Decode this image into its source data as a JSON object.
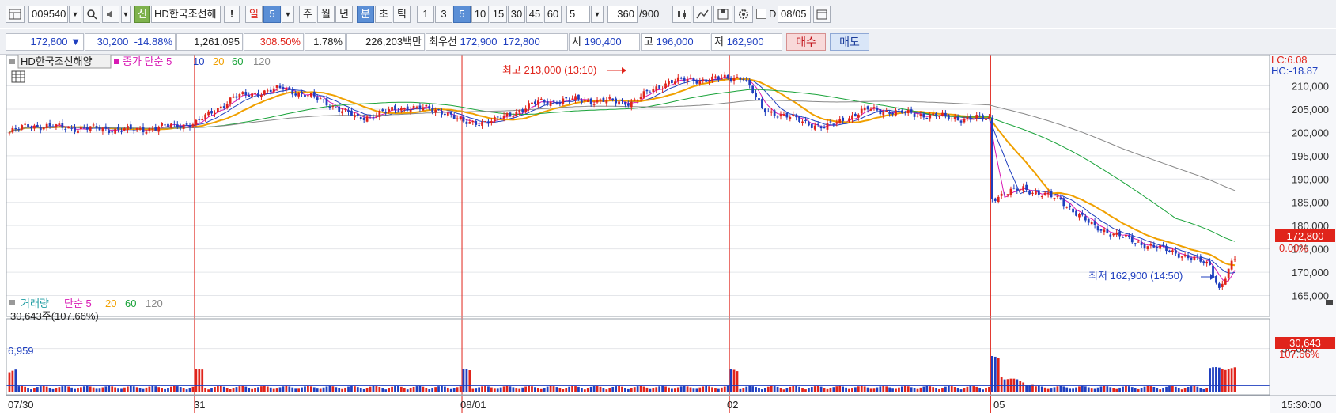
{
  "toolbar": {
    "code": "009540",
    "name_badge": "신",
    "name": "HD한국조선해",
    "alert": "!",
    "period_day": "일",
    "period_day_n": "5",
    "period_week": "주",
    "period_month": "월",
    "period_year": "년",
    "period_minute": "분",
    "period_second": "초",
    "period_tick": "틱",
    "intervals": [
      "1",
      "3",
      "5",
      "10",
      "15",
      "30",
      "45",
      "60"
    ],
    "interval_value": "5",
    "count": "360",
    "count_total": "/900",
    "checkbox_label": "D",
    "date": "08/05"
  },
  "infobar": {
    "price": "172,800",
    "change_arrow": "▼",
    "change": "30,200",
    "change_pct": "-14.88%",
    "volume": "1,261,095",
    "volume_ratio": "308.50%",
    "turnover": "1.78%",
    "amount": "226,203백만",
    "best_label": "최우선",
    "best_ask": "172,900",
    "best_bid": "172,800",
    "open_label": "시",
    "open": "190,400",
    "high_label": "고",
    "high": "196,000",
    "low_label": "저",
    "low": "162,900",
    "buy_label": "매수",
    "sell_label": "매도"
  },
  "price_panel": {
    "name": "HD한국조선해양",
    "series_label": "종가 단순 5",
    "ma_labels": [
      "10",
      "20",
      "60",
      "120"
    ],
    "ma_colors": [
      "#1f3fbf",
      "#f0a000",
      "#1aa33a",
      "#888888"
    ],
    "ma5_color": "#d81ab4",
    "lc_text": "LC:6.08",
    "hc_text": "HC:-18.87",
    "high_annotation": "최고 213,000 (13:10)",
    "low_annotation": "최저 162,900 (14:50)",
    "current_price_label": "172,800",
    "current_pct_label": "0.00%"
  },
  "volume_panel": {
    "title": "거래량",
    "series_label": "단순 5",
    "ma_labels": [
      "20",
      "60",
      "120"
    ],
    "current_text": "30,643주(107.66%)",
    "left_value": "6,959",
    "right_value": "30,643",
    "right_pct": "107.66%"
  },
  "x_axis": {
    "labels": [
      "07/30",
      "31",
      "08/01",
      "02",
      "05"
    ],
    "time_label": "15:30:00"
  },
  "chart_data": {
    "type": "candlestick",
    "title": "HD한국조선해양",
    "interval": "5분",
    "y_ticks": [
      165000,
      170000,
      175000,
      180000,
      185000,
      190000,
      195000,
      200000,
      205000,
      210000
    ],
    "ylim": [
      160500,
      214000
    ],
    "day_labels": [
      "07/30",
      "31",
      "08/01",
      "02",
      "05"
    ],
    "day_anchors": [
      {
        "index": 0,
        "price": 200000
      },
      {
        "index": 6,
        "price": 201500
      },
      {
        "index": 20,
        "price": 201000
      },
      {
        "index": 40,
        "price": 200500
      },
      {
        "index": 60,
        "price": 202000
      },
      {
        "index": 72,
        "price": 207500
      },
      {
        "index": 88,
        "price": 209500
      },
      {
        "index": 100,
        "price": 207000
      },
      {
        "index": 112,
        "price": 203000
      },
      {
        "index": 128,
        "price": 205500
      },
      {
        "index": 140,
        "price": 204500
      },
      {
        "index": 146,
        "price": 202000
      },
      {
        "index": 156,
        "price": 202500
      },
      {
        "index": 170,
        "price": 206500
      },
      {
        "index": 182,
        "price": 207000
      },
      {
        "index": 200,
        "price": 206500
      },
      {
        "index": 212,
        "price": 211000
      },
      {
        "index": 228,
        "price": 211500
      },
      {
        "index": 236,
        "price": 212000
      },
      {
        "index": 242,
        "price": 205000
      },
      {
        "index": 252,
        "price": 203000
      },
      {
        "index": 262,
        "price": 201000
      },
      {
        "index": 276,
        "price": 205000
      },
      {
        "index": 290,
        "price": 204000
      },
      {
        "index": 306,
        "price": 203000
      },
      {
        "index": 315,
        "price": 203000
      },
      {
        "index": 316,
        "price": 186000
      },
      {
        "index": 326,
        "price": 188000
      },
      {
        "index": 338,
        "price": 185500
      },
      {
        "index": 348,
        "price": 180000
      },
      {
        "index": 362,
        "price": 176500
      },
      {
        "index": 376,
        "price": 174000
      },
      {
        "index": 386,
        "price": 171500
      },
      {
        "index": 389,
        "price": 166500
      },
      {
        "index": 394,
        "price": 173000
      }
    ],
    "day_boundaries": [
      0,
      60,
      146,
      232,
      316,
      395
    ],
    "high": {
      "price": 213000,
      "time": "13:10"
    },
    "low": {
      "price": 162900,
      "time": "14:50"
    },
    "last_close": 172800,
    "volume_ticks": [
      50000
    ],
    "volume_ylim": [
      0,
      80000
    ]
  }
}
